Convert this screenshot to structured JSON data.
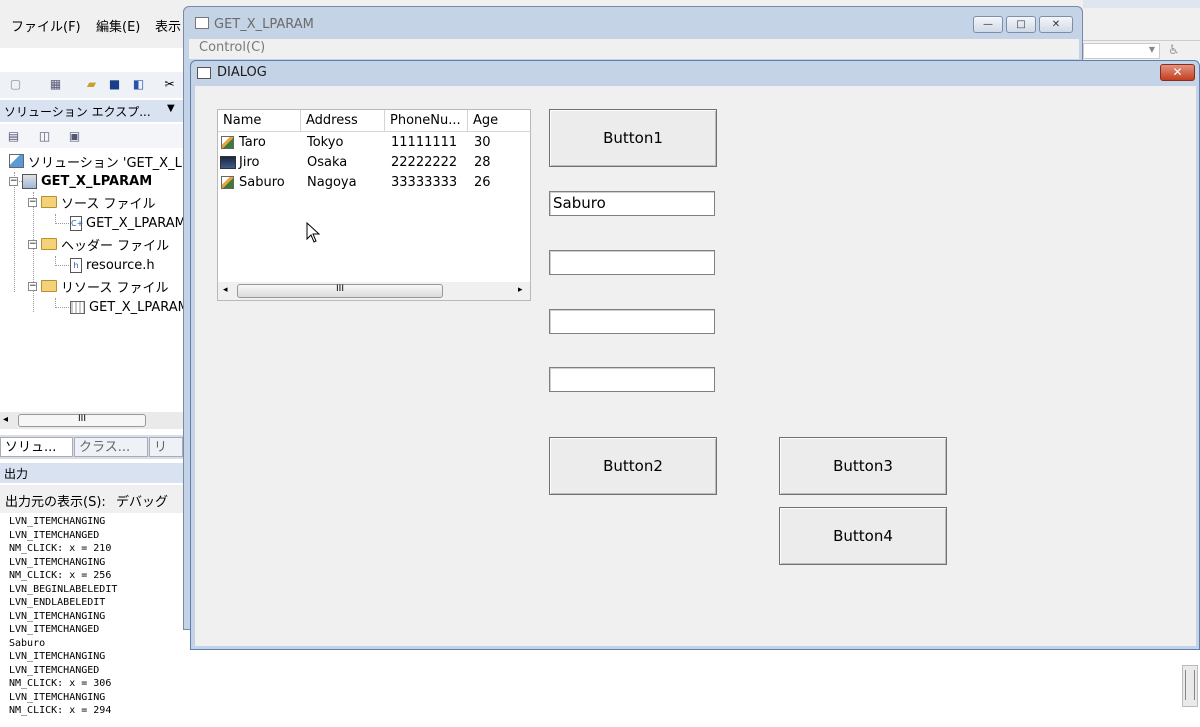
{
  "ide": {
    "menu": [
      "ファイル(F)",
      "編集(E)",
      "表示"
    ],
    "solution_explorer": {
      "header": "ソリューション エクスプ...",
      "tree": [
        {
          "label": "ソリューション 'GET_X_L"
        },
        {
          "label": "GET_X_LPARAM"
        },
        {
          "label": "ソース ファイル"
        },
        {
          "label": "GET_X_LPARAM"
        },
        {
          "label": "ヘッダー ファイル"
        },
        {
          "label": "resource.h"
        },
        {
          "label": "リソース ファイル"
        },
        {
          "label": "GET_X_LPARAM"
        }
      ],
      "tabs": [
        "ソリュ...",
        "クラス...",
        "リ"
      ]
    },
    "output": {
      "header": "出力",
      "source_label": "出力元の表示(S):",
      "source_value": "デバッグ",
      "lines": [
        "LVN_ITEMCHANGING",
        "LVN_ITEMCHANGED",
        "NM_CLICK: x = 210",
        "LVN_ITEMCHANGING",
        "NM_CLICK: x = 256",
        "LVN_BEGINLABELEDIT",
        "LVN_ENDLABELEDIT",
        "LVN_ITEMCHANGING",
        "LVN_ITEMCHANGED",
        "Saburo",
        "LVN_ITEMCHANGING",
        "LVN_ITEMCHANGED",
        "NM_CLICK: x = 306",
        "LVN_ITEMCHANGING",
        "NM_CLICK: x = 294"
      ]
    }
  },
  "main_window": {
    "title": "GET_X_LPARAM",
    "menu_label": "Control(C)",
    "caption_buttons": {
      "minimize": "—",
      "maximize": "□",
      "close": "✕"
    }
  },
  "dialog": {
    "title": "DIALOG",
    "close_glyph": "✕",
    "listview": {
      "columns": [
        "Name",
        "Address",
        "PhoneNu...",
        "Age"
      ],
      "rows": [
        {
          "name": "Taro",
          "address": "Tokyo",
          "phone": "11111111",
          "age": "30",
          "icon": "pencil-icon"
        },
        {
          "name": "Jiro",
          "address": "Osaka",
          "phone": "22222222",
          "age": "28",
          "icon": "monitor-icon"
        },
        {
          "name": "Saburo",
          "address": "Nagoya",
          "phone": "33333333",
          "age": "26",
          "icon": "pencil-icon"
        }
      ],
      "scroll_thumb_glyph": "III"
    },
    "buttons": {
      "button1": "Button1",
      "button2": "Button2",
      "button3": "Button3",
      "button4": "Button4"
    },
    "edits": {
      "edit1": "Saburo",
      "edit2": "",
      "edit3": "",
      "edit4": ""
    }
  }
}
